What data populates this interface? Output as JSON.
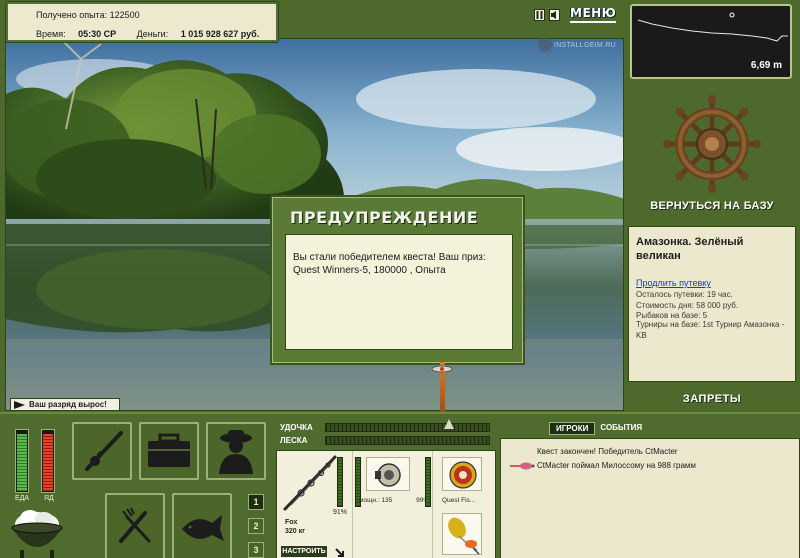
{
  "header": {
    "exp_label": "Получено опыта:",
    "exp_value": "122500",
    "time_label": "Время:",
    "time_value": "05:30 CP",
    "money_label": "Деньги:",
    "money_value": "1 015 928 627 руб.",
    "pause_icon": "pause-icon",
    "sound_icon": "sound-icon",
    "menu_label": "МЕНЮ",
    "watermark": "INSTALLGEIM.RU"
  },
  "depth": {
    "value": "6,69 m"
  },
  "base": {
    "return_label": "ВЕРНУТЬСЯ НА БАЗУ",
    "wheel_icon": "ship-wheel-icon",
    "location_title": "Амазонка. Зелёный великан",
    "extend_link": "Продлить путевку",
    "lines": [
      "Осталось путевки: 19 час.",
      "Стоимость дня: 58 000 руб.",
      "Рыбаков на базе: 5"
    ],
    "tournament": "Турниры на базе: 1st Турнир Амазонка - KB",
    "bans_label": "ЗАПРЕТЫ"
  },
  "dialog": {
    "title": "ПРЕДУПРЕЖДЕНИЕ",
    "message": "Вы стали победителем квеста! Ваш приз: Quest Winners-5, 180000 , Опыта"
  },
  "rank_badge": "Ваш разряд вырос!",
  "status": {
    "food_label": "ЕДА",
    "poison_label": "ЯД",
    "food_level": 0.95,
    "poison_level": 0.95
  },
  "slots": {
    "tabs": [
      "1",
      "2",
      "3"
    ],
    "active_tab": "1"
  },
  "tackle": {
    "rod_label": "УДОЧКА",
    "line_label": "ЛЕСКА",
    "rod_name": "Fox",
    "rod_weight": "320 кг",
    "rod_pct": "91%",
    "setup_label": "НАСТРОИТЬ",
    "reel_label": "мощн.: 135",
    "reel_pct": "99%",
    "line_name": "Quest Fis..."
  },
  "events": {
    "tab_players": "ИГРОКИ",
    "tab_events": "СОБЫТИЯ",
    "items": [
      "Квест закончен! Победитель CtMacter",
      "CtMacter поймал Милоссому на 988 грамм"
    ]
  },
  "colors": {
    "panel_green": "#4d6a2c",
    "panel_cream": "#ebe8cd",
    "link_blue": "#1a3fae"
  }
}
